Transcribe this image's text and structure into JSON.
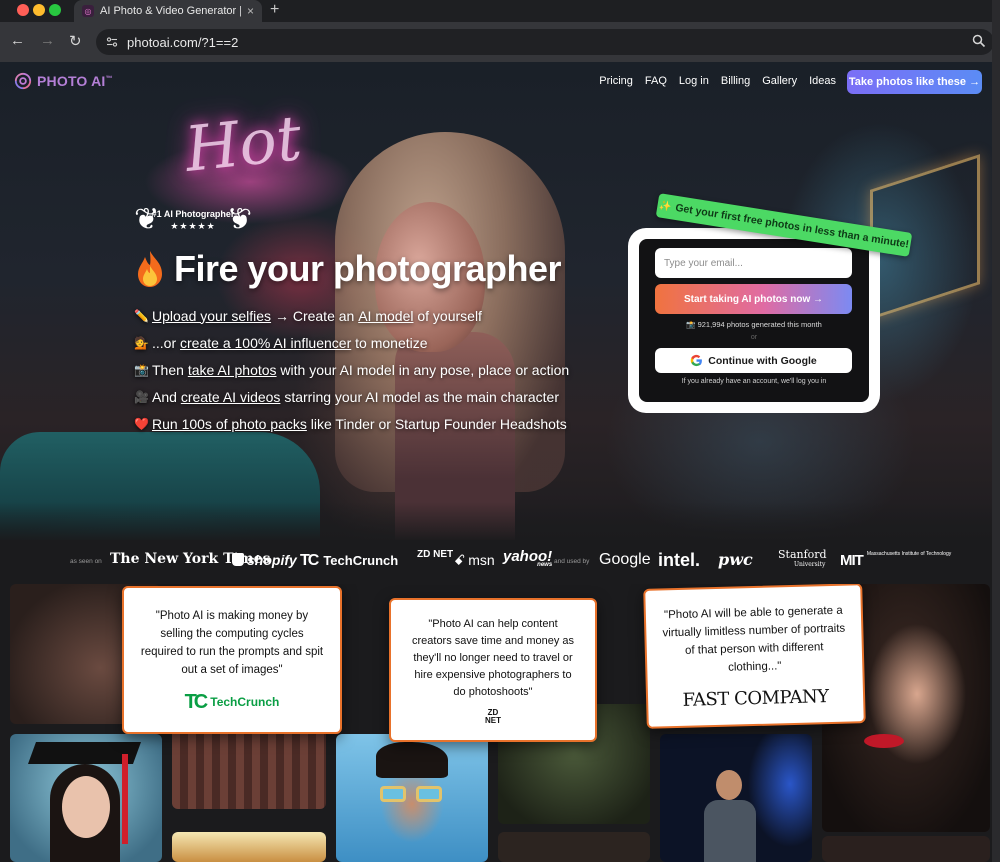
{
  "browser": {
    "tab_title": "AI Photo & Video Generator |",
    "new_tab_symbol": "+",
    "url": "photoai.com/?1==2"
  },
  "header": {
    "logo_text": "PHOTO AI",
    "logo_mark": "™",
    "nav": [
      "Pricing",
      "FAQ",
      "Log in",
      "Billing",
      "Gallery",
      "Ideas"
    ],
    "cta": "Take photos like these →"
  },
  "hero": {
    "neon_sign": "Hot",
    "badge": {
      "label": "#1 AI Photographer",
      "stars": "★★★★★"
    },
    "headline": "Fire your photographer",
    "features": [
      {
        "emoji": "✏️",
        "parts": [
          {
            "t": "Upload your selfies",
            "u": true
          },
          {
            "t": " → Create an ",
            "u": false
          },
          {
            "t": "AI model",
            "u": true
          },
          {
            "t": " of yourself",
            "u": false
          }
        ]
      },
      {
        "emoji": "💁",
        "parts": [
          {
            "t": "...or ",
            "u": false
          },
          {
            "t": "create a 100% AI influencer",
            "u": true
          },
          {
            "t": " to monetize",
            "u": false
          }
        ]
      },
      {
        "emoji": "📸",
        "parts": [
          {
            "t": "Then ",
            "u": false
          },
          {
            "t": "take AI photos",
            "u": true
          },
          {
            "t": " with your AI model in any pose, place or action",
            "u": false
          }
        ]
      },
      {
        "emoji": "🎥",
        "parts": [
          {
            "t": "And ",
            "u": false
          },
          {
            "t": "create AI videos",
            "u": true
          },
          {
            "t": " starring your AI model as the main character",
            "u": false
          }
        ]
      },
      {
        "emoji": "❤️",
        "parts": [
          {
            "t": "Run 100s of photo packs",
            "u": true
          },
          {
            "t": " like Tinder or Startup Founder Headshots",
            "u": false
          }
        ]
      }
    ]
  },
  "signup": {
    "ribbon": "Get your first free photos in less than a minute!",
    "email_placeholder": "Type your email...",
    "cta": "Start taking AI photos now →",
    "generated": "📸 921,994 photos generated this month",
    "or": "or",
    "google": "Continue with Google",
    "login_note": "If you already have an account, we'll log you in"
  },
  "press": {
    "as_seen_on": "as seen on",
    "nyt": "The New York Times",
    "shopify": "shopify",
    "techcrunch": "TechCrunch",
    "zdnet": "ZD NET",
    "msn": "msn",
    "yahoo": "yahoo!",
    "yahoo_sub": "news",
    "used_by": "and used by",
    "google": "Google",
    "intel": "intel.",
    "pwc": "pwc",
    "stanford": "Stanford",
    "stanford_sub": "University",
    "mit": "MIT",
    "mit_sub": "Massachusetts Institute of Technology"
  },
  "quotes": [
    {
      "text": "\"Photo AI is making money by selling the computing cycles required to run the prompts and spit out a set of images\"",
      "source": "TechCrunch"
    },
    {
      "text": "\"Photo AI can help content creators save time and money as they'll no longer need to travel or hire expensive photographers to do photoshoots\"",
      "source": "ZD NET"
    },
    {
      "text": "\"Photo AI will be able to generate a virtually limitless number of portraits of that person with different clothing...\"",
      "source": "FAST COMPANY"
    }
  ],
  "colors": {
    "brand_purple": "#b47fd6",
    "cta_gradient": [
      "#f0733f",
      "#e06ba3",
      "#7c8af2"
    ],
    "ribbon_green": "#4cd964",
    "quote_border": "#e8722b"
  }
}
